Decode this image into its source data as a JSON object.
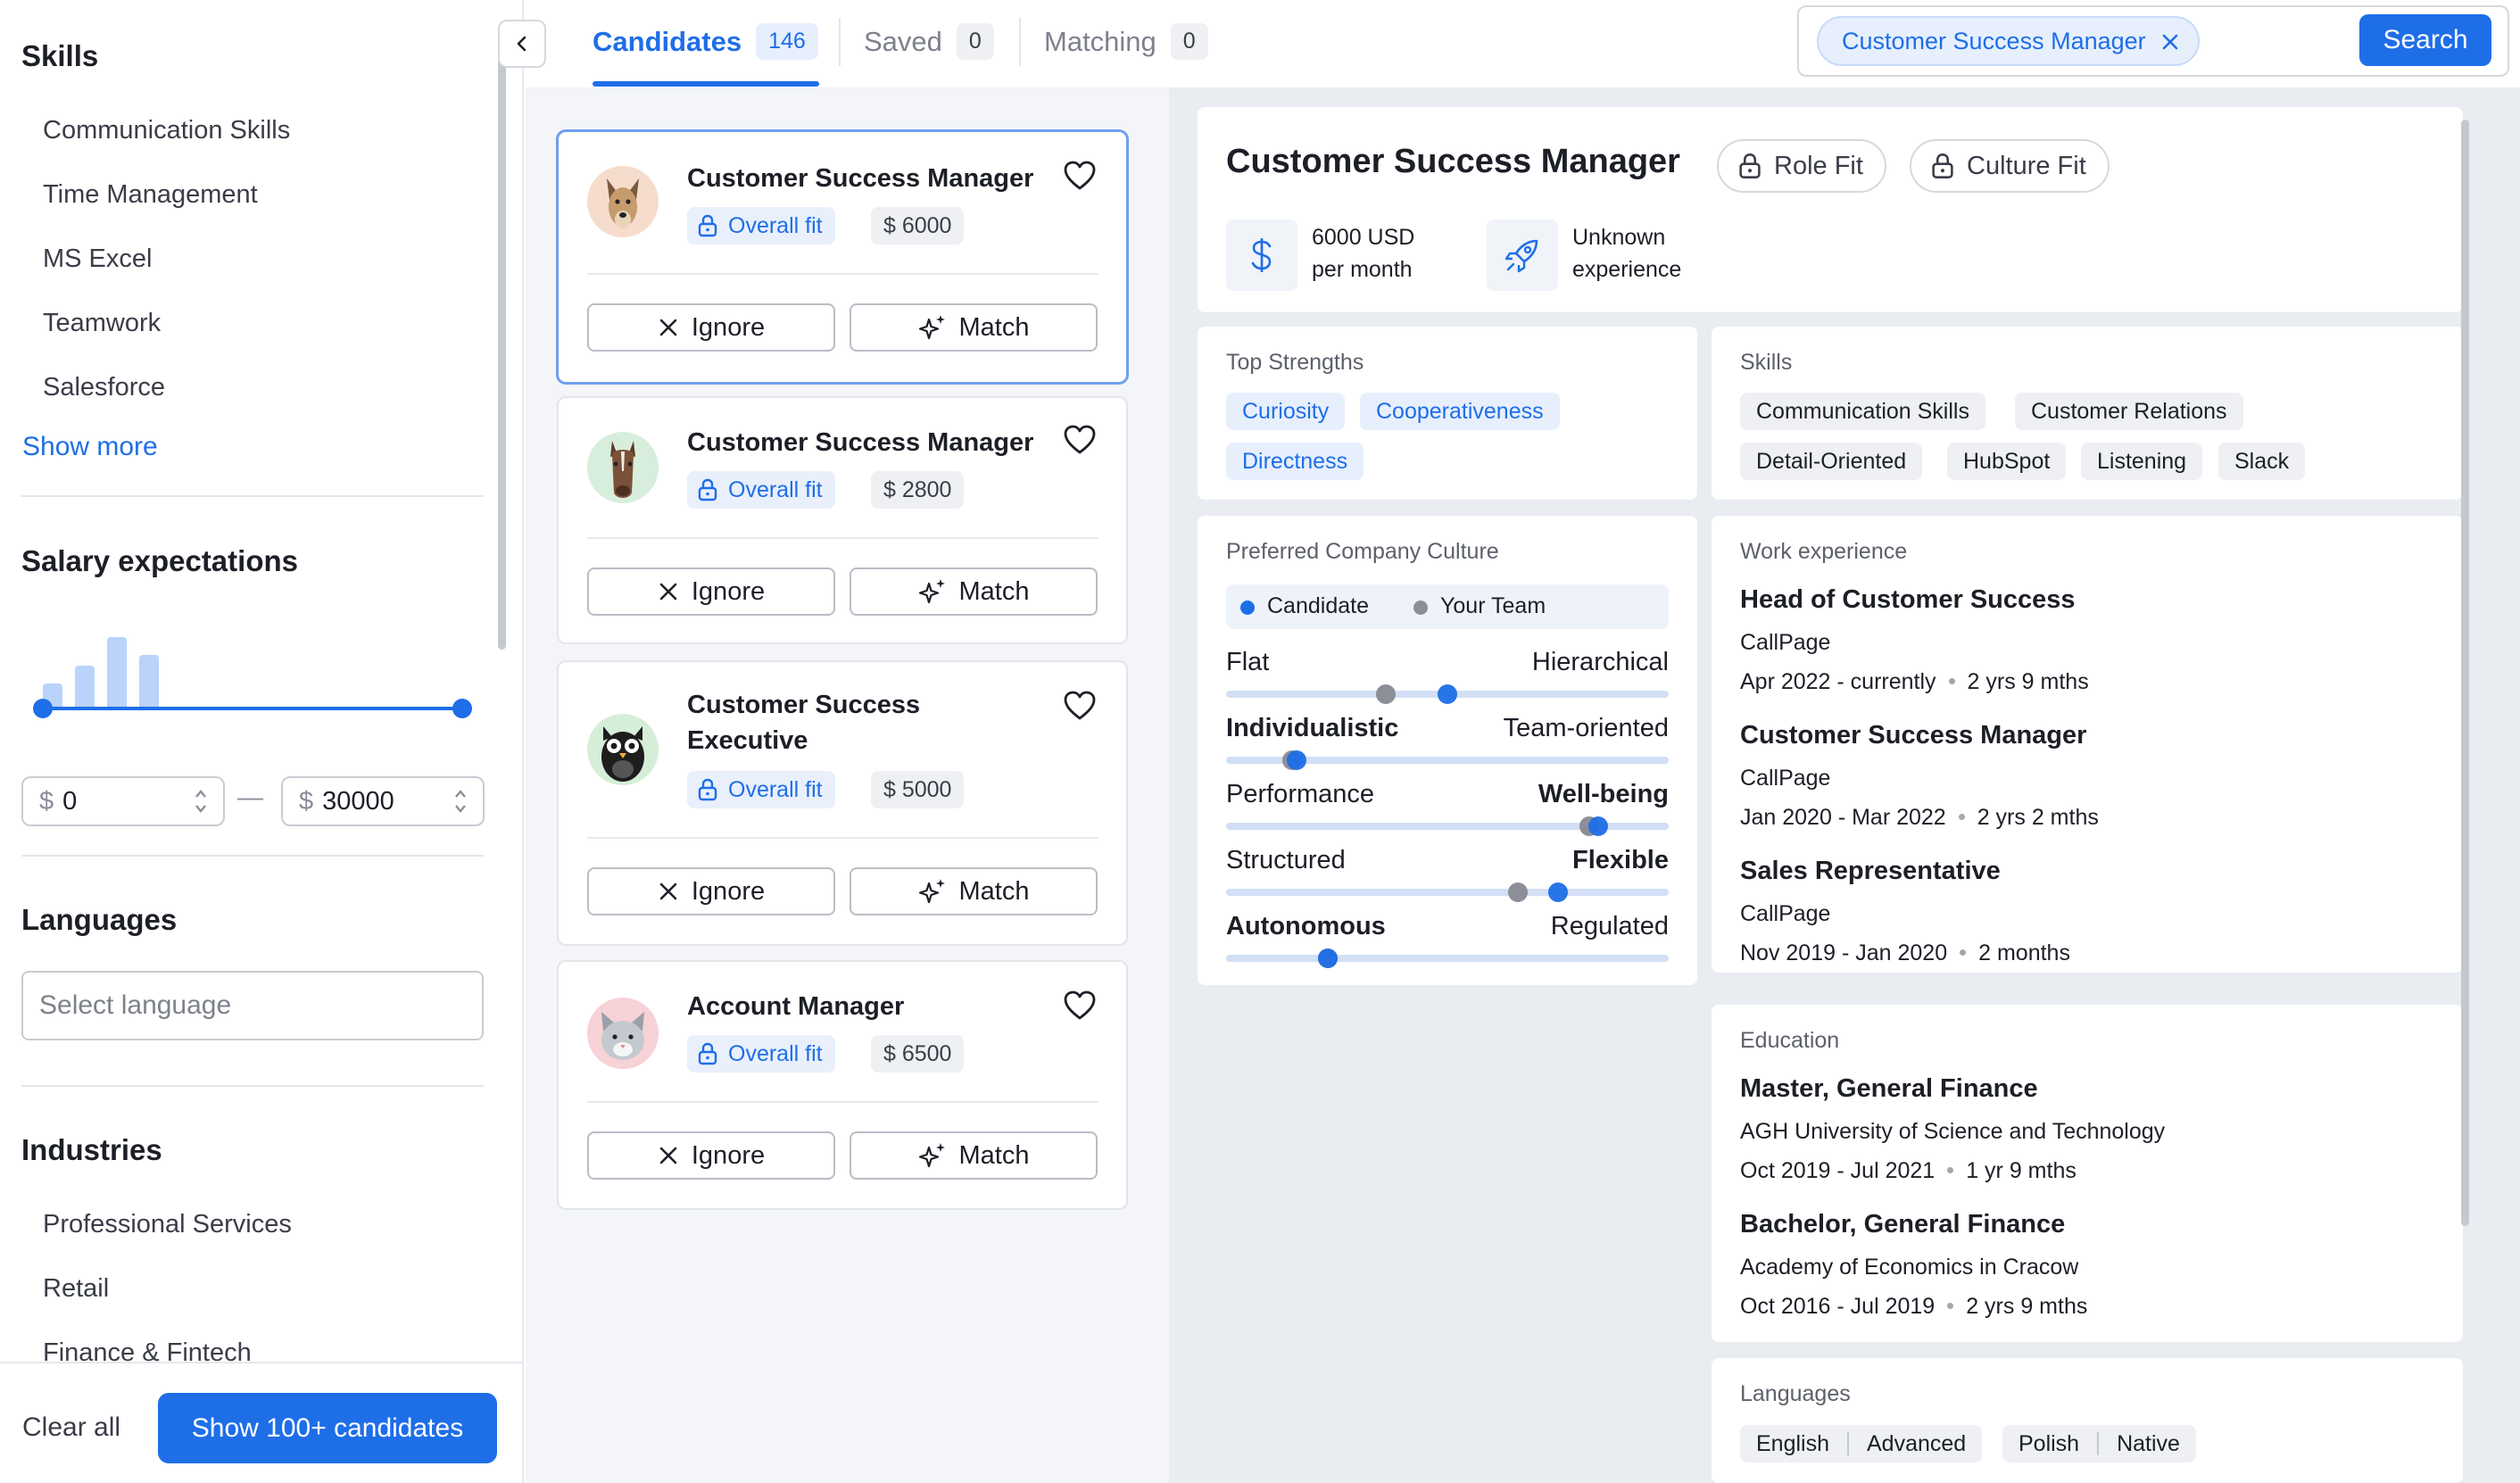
{
  "filters": {
    "skills_title": "Skills",
    "skills": [
      "Communication Skills",
      "Time Management",
      "MS Excel",
      "Teamwork",
      "Salesforce"
    ],
    "show_more": "Show more",
    "salary_title": "Salary expectations",
    "salary_min": "0",
    "salary_max": "30000",
    "currency_symbol": "$",
    "range_separator": "—",
    "languages_title": "Languages",
    "language_placeholder": "Select language",
    "industries_title": "Industries",
    "industries": [
      "Professional Services",
      "Retail",
      "Finance & Fintech"
    ],
    "clear_all": "Clear all",
    "show_button": "Show 100+ candidates"
  },
  "tabs": [
    {
      "label": "Candidates",
      "count": "146",
      "active": true
    },
    {
      "label": "Saved",
      "count": "0",
      "active": false
    },
    {
      "label": "Matching",
      "count": "0",
      "active": false
    }
  ],
  "search": {
    "chip": "Customer Success Manager",
    "button": "Search"
  },
  "candidates": [
    {
      "title": "Customer Success Manager",
      "fit": "Overall fit",
      "salary": "$ 6000",
      "avatar": "dog-avatar-icon",
      "selected": true
    },
    {
      "title": "Customer Success Manager",
      "fit": "Overall fit",
      "salary": "$ 2800",
      "avatar": "horse-avatar-icon",
      "selected": false
    },
    {
      "title": "Customer Success Executive",
      "fit": "Overall fit",
      "salary": "$ 5000",
      "avatar": "owl-avatar-icon",
      "selected": false
    },
    {
      "title": "Account Manager",
      "fit": "Overall fit",
      "salary": "$ 6500",
      "avatar": "cat-avatar-icon",
      "selected": false
    }
  ],
  "card_actions": {
    "ignore": "Ignore",
    "match": "Match"
  },
  "detail": {
    "title": "Customer Success Manager",
    "role_fit": "Role Fit",
    "culture_fit": "Culture Fit",
    "salary_line1": "6000 USD",
    "salary_line2": "per month",
    "experience_line1": "Unknown",
    "experience_line2": "experience",
    "strengths_title": "Top Strengths",
    "strengths": [
      "Curiosity",
      "Cooperativeness",
      "Directness"
    ],
    "skills_title": "Skills",
    "skills": [
      "Communication Skills",
      "Customer Relations",
      "Detail-Oriented",
      "HubSpot",
      "Listening",
      "Slack"
    ],
    "culture_title": "Preferred Company Culture",
    "legend": {
      "candidate": "Candidate",
      "team": "Your Team"
    },
    "culture_scales": [
      {
        "left": "Flat",
        "right": "Hierarchical",
        "bold": "none",
        "candidate": 0.5,
        "team": 0.36
      },
      {
        "left": "Individualistic",
        "right": "Team-oriented",
        "bold": "left",
        "candidate": 0.16,
        "team": 0.15
      },
      {
        "left": "Performance",
        "right": "Well-being",
        "bold": "right",
        "candidate": 0.84,
        "team": 0.82
      },
      {
        "left": "Structured",
        "right": "Flexible",
        "bold": "right",
        "candidate": 0.75,
        "team": 0.66
      },
      {
        "left": "Autonomous",
        "right": "Regulated",
        "bold": "left",
        "candidate": 0.23,
        "team": 0.23
      }
    ],
    "work_title": "Work experience",
    "work": [
      {
        "title": "Head of Customer Success",
        "company": "CallPage",
        "dates": "Apr 2022 - currently",
        "duration": "2 yrs 9 mths"
      },
      {
        "title": "Customer Success Manager",
        "company": "CallPage",
        "dates": "Jan 2020 - Mar 2022",
        "duration": "2 yrs 2 mths"
      },
      {
        "title": "Sales Representative",
        "company": "CallPage",
        "dates": "Nov 2019 - Jan 2020",
        "duration": "2 months"
      }
    ],
    "education_title": "Education",
    "education": [
      {
        "title": "Master, General Finance",
        "school": "AGH University of Science and Technology",
        "dates": "Oct 2019 - Jul 2021",
        "duration": "1 yr 9 mths"
      },
      {
        "title": "Bachelor, General Finance",
        "school": "Academy of Economics in Cracow",
        "dates": "Oct 2016 - Jul 2019",
        "duration": "2 yrs 9 mths"
      }
    ],
    "languages_title": "Languages",
    "languages": [
      {
        "language": "English",
        "level": "Advanced"
      },
      {
        "language": "Polish",
        "level": "Native"
      }
    ]
  },
  "colors": {
    "accent": "#1e6ee8",
    "candidate_dot": "#1e6ee8",
    "team_dot": "#8c8f97",
    "tag_blue_bg": "#e7effc"
  }
}
